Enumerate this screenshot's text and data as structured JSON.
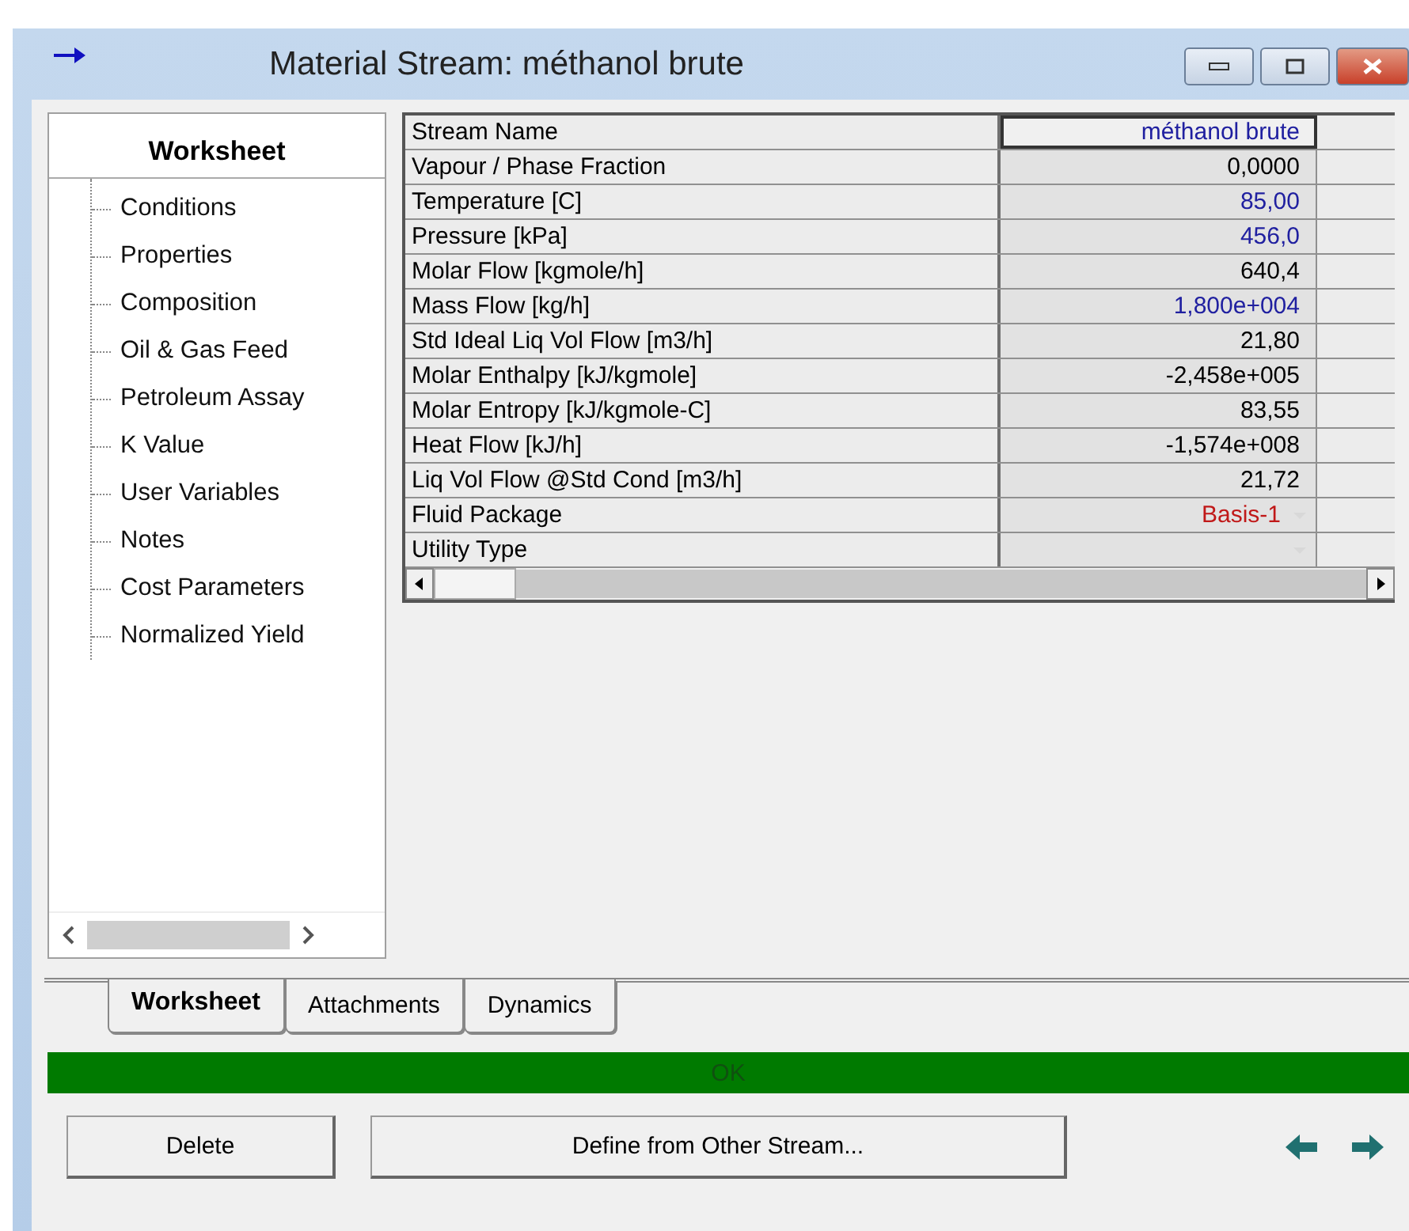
{
  "window": {
    "title": "Material Stream: méthanol brute"
  },
  "sidebar": {
    "title": "Worksheet",
    "items": [
      {
        "label": "Conditions"
      },
      {
        "label": "Properties"
      },
      {
        "label": "Composition"
      },
      {
        "label": "Oil & Gas Feed"
      },
      {
        "label": "Petroleum Assay"
      },
      {
        "label": "K Value"
      },
      {
        "label": "User Variables"
      },
      {
        "label": "Notes"
      },
      {
        "label": "Cost Parameters"
      },
      {
        "label": "Normalized Yield"
      }
    ]
  },
  "table": {
    "rows": [
      {
        "label": "Stream Name",
        "value": "méthanol brute",
        "color": "#2020a0",
        "kind": "text",
        "selected": true
      },
      {
        "label": "Vapour / Phase Fraction",
        "value": "0,0000",
        "color": "#000000",
        "kind": "text",
        "selected": false
      },
      {
        "label": "Temperature [C]",
        "value": "85,00",
        "color": "#2020a0",
        "kind": "text",
        "selected": false
      },
      {
        "label": "Pressure [kPa]",
        "value": "456,0",
        "color": "#2020a0",
        "kind": "text",
        "selected": false
      },
      {
        "label": "Molar Flow [kgmole/h]",
        "value": "640,4",
        "color": "#000000",
        "kind": "text",
        "selected": false
      },
      {
        "label": "Mass Flow [kg/h]",
        "value": "1,800e+004",
        "color": "#2020a0",
        "kind": "text",
        "selected": false
      },
      {
        "label": "Std Ideal Liq Vol Flow [m3/h]",
        "value": "21,80",
        "color": "#000000",
        "kind": "text",
        "selected": false
      },
      {
        "label": "Molar Enthalpy [kJ/kgmole]",
        "value": "-2,458e+005",
        "color": "#000000",
        "kind": "text",
        "selected": false
      },
      {
        "label": "Molar Entropy [kJ/kgmole-C]",
        "value": "83,55",
        "color": "#000000",
        "kind": "text",
        "selected": false
      },
      {
        "label": "Heat Flow [kJ/h]",
        "value": "-1,574e+008",
        "color": "#000000",
        "kind": "text",
        "selected": false
      },
      {
        "label": "Liq Vol Flow @Std Cond [m3/h]",
        "value": "21,72",
        "color": "#000000",
        "kind": "text",
        "selected": false
      },
      {
        "label": "Fluid Package",
        "value": "Basis-1",
        "color": "#c01818",
        "kind": "dropdown",
        "selected": false
      },
      {
        "label": "Utility Type",
        "kind": "dropdown",
        "selected": false
      }
    ]
  },
  "tabs": [
    {
      "label": "Worksheet",
      "selected": true
    },
    {
      "label": "Attachments",
      "selected": false
    },
    {
      "label": "Dynamics",
      "selected": false
    }
  ],
  "status_bar": {
    "text": "OK"
  },
  "buttons": [
    {
      "label": "Delete"
    },
    {
      "label": "Define from Other Stream..."
    }
  ]
}
